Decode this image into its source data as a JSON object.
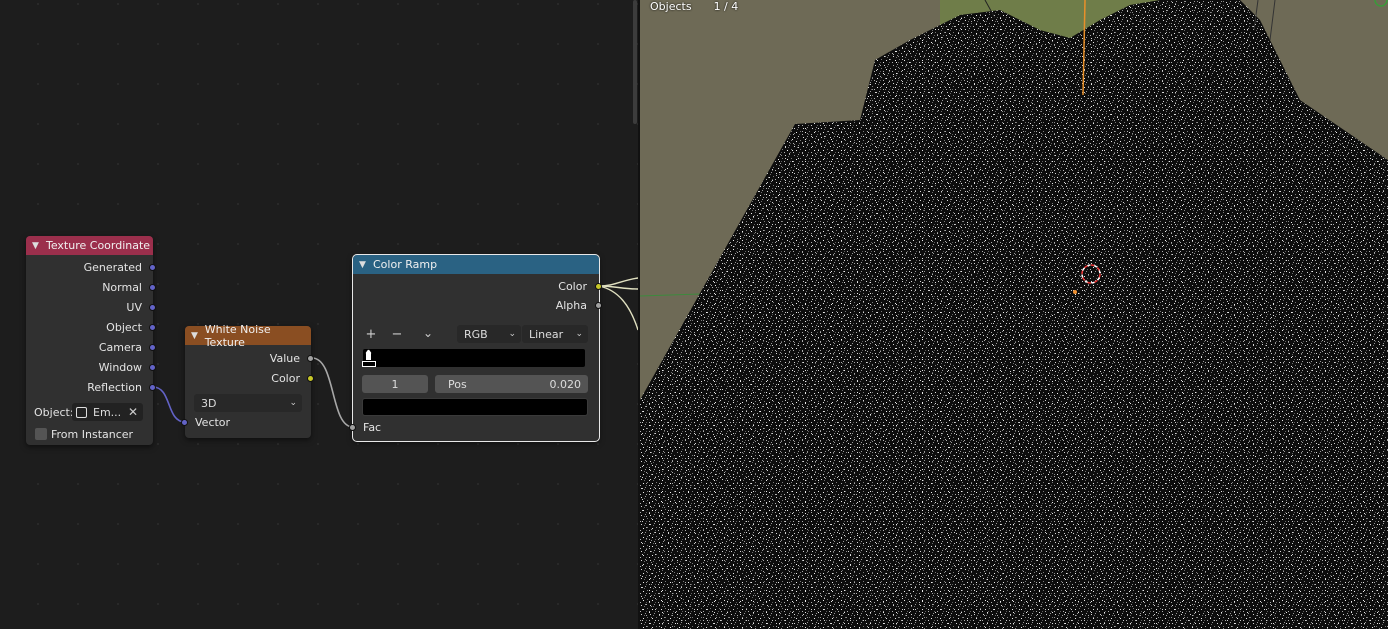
{
  "node_editor": {
    "texture_coordinate": {
      "title": "Texture Coordinate",
      "outputs": [
        "Generated",
        "Normal",
        "UV",
        "Object",
        "Camera",
        "Window",
        "Reflection"
      ],
      "object_label": "Object:",
      "object_value": "Em...",
      "from_instancer_label": "From Instancer",
      "from_instancer_checked": false
    },
    "white_noise": {
      "title": "White Noise Texture",
      "outputs": [
        "Value",
        "Color"
      ],
      "dimensions": "3D",
      "input_vector": "Vector"
    },
    "color_ramp": {
      "title": "Color Ramp",
      "outputs": [
        "Color",
        "Alpha"
      ],
      "add_icon": "+",
      "remove_icon": "−",
      "menu_icon": "⌄",
      "color_mode": "RGB",
      "interpolation": "Linear",
      "stop_index": "1",
      "pos_label": "Pos",
      "pos_value": "0.020",
      "input_fac": "Fac"
    }
  },
  "viewport": {
    "header": {
      "mode": "Objects",
      "count": "1 / 4"
    }
  }
}
